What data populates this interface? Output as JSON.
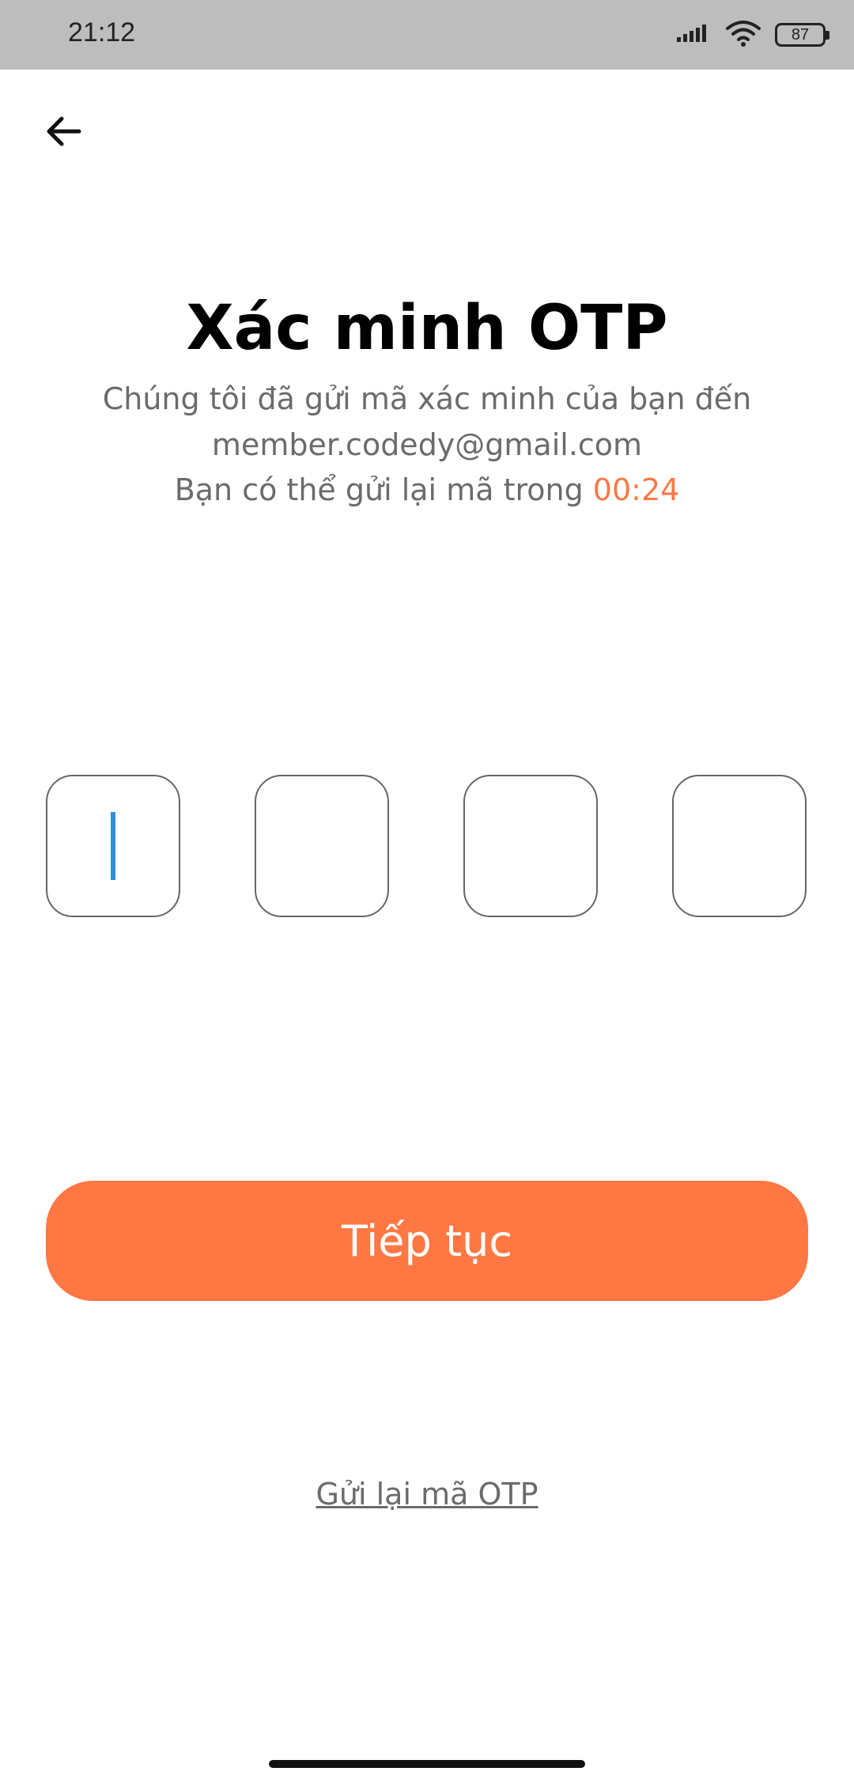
{
  "status_bar": {
    "time": "21:12",
    "battery": "87",
    "icons": [
      "signal-icon",
      "wifi-icon",
      "battery-icon"
    ]
  },
  "header": {
    "back_icon": "arrow-left-icon"
  },
  "content": {
    "title": "Xác minh OTP",
    "line1": "Chúng tôi đã gửi mã xác minh của bạn đến",
    "email": "member.codedy@gmail.com",
    "line3_prefix": "Bạn có thể gửi lại mã trong ",
    "timer": "00:24"
  },
  "otp": {
    "digits": [
      "",
      "",
      "",
      ""
    ]
  },
  "actions": {
    "continue_label": "Tiếp tục",
    "resend_label": "Gửi lại mã OTP"
  },
  "colors": {
    "accent": "#ff7843",
    "caret": "#2e8fdd",
    "muted_text": "#6b6b6b",
    "status_bar_bg": "#bdbdbd"
  }
}
